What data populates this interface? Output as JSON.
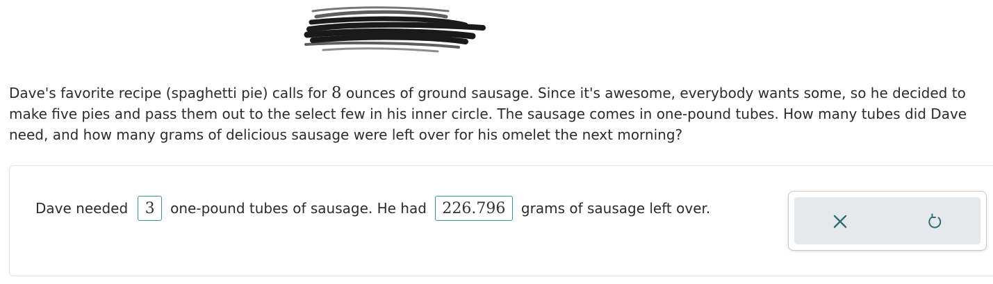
{
  "question": {
    "part1": "Dave's favorite recipe (spaghetti pie) calls for ",
    "ounces": "8",
    "part2": " ounces of ground sausage. Since it's awesome, everybody wants some, so he decided to make five pies and pass them out to the select few in his inner circle. The sausage comes in one-pound tubes. How many tubes did Dave need, and how many grams of delicious sausage were left over for his omelet the next morning?"
  },
  "answer": {
    "prefix": "Dave needed",
    "tubes_value": "3",
    "middle": "one-pound tubes of sausage. He had",
    "grams_value": "226.796",
    "suffix": "grams of sausage left over."
  },
  "toolbar": {
    "clear_icon": "close-icon",
    "undo_icon": "undo-icon",
    "icon_color": "#2f6b78"
  }
}
